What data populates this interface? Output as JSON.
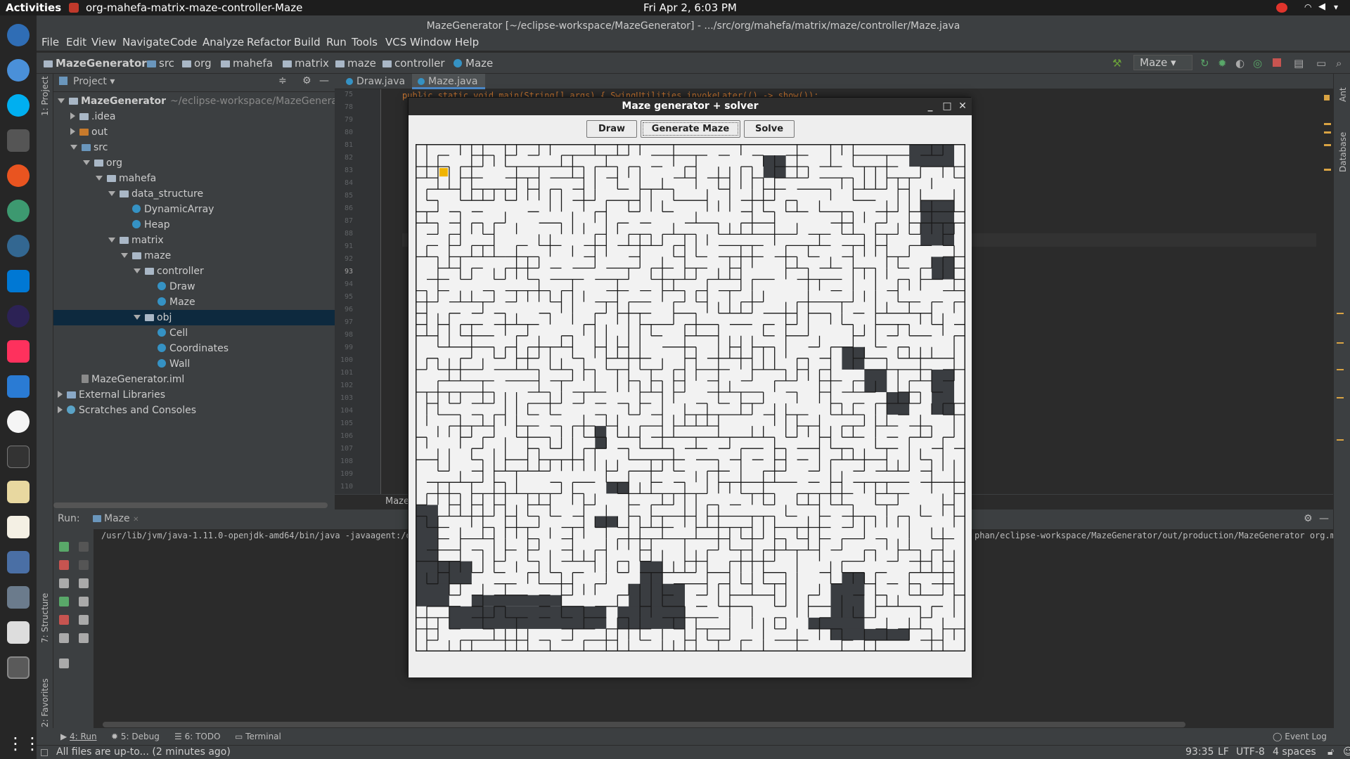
{
  "topbar": {
    "activities": "Activities",
    "app_name": "org-mahefa-matrix-maze-controller-Maze",
    "clock": "Fri Apr  2,  6:03 PM"
  },
  "ide": {
    "title": "MazeGenerator [~/eclipse-workspace/MazeGenerator] - .../src/org/mahefa/matrix/maze/controller/Maze.java",
    "menus": [
      "File",
      "Edit",
      "View",
      "Navigate",
      "Code",
      "Analyze",
      "Refactor",
      "Build",
      "Run",
      "Tools",
      "VCS",
      "Window",
      "Help"
    ],
    "breadcrumbs": [
      "MazeGenerator",
      "src",
      "org",
      "mahefa",
      "matrix",
      "maze",
      "controller",
      "Maze"
    ],
    "run_config": "Maze"
  },
  "project": {
    "header": "Project",
    "side_tab": "1: Project",
    "tree": [
      {
        "label": "MazeGenerator",
        "extra": "~/eclipse-workspace/MazeGenerator",
        "icon": "folder"
      },
      {
        "label": ".idea",
        "icon": "folder"
      },
      {
        "label": "out",
        "icon": "folder-orange"
      },
      {
        "label": "src",
        "icon": "folder-blue"
      },
      {
        "label": "org",
        "icon": "folder"
      },
      {
        "label": "mahefa",
        "icon": "folder"
      },
      {
        "label": "data_structure",
        "icon": "folder"
      },
      {
        "label": "DynamicArray",
        "icon": "class"
      },
      {
        "label": "Heap",
        "icon": "class"
      },
      {
        "label": "matrix",
        "icon": "folder"
      },
      {
        "label": "maze",
        "icon": "folder"
      },
      {
        "label": "controller",
        "icon": "folder"
      },
      {
        "label": "Draw",
        "icon": "class"
      },
      {
        "label": "Maze",
        "icon": "class"
      },
      {
        "label": "obj",
        "icon": "folder"
      },
      {
        "label": "Cell",
        "icon": "class"
      },
      {
        "label": "Coordinates",
        "icon": "class"
      },
      {
        "label": "Wall",
        "icon": "class"
      },
      {
        "label": "MazeGenerator.iml",
        "icon": "file"
      },
      {
        "label": "External Libraries",
        "icon": "library"
      },
      {
        "label": "Scratches and Consoles",
        "icon": "scratch"
      }
    ]
  },
  "editor": {
    "tabs": [
      "Draw.java",
      "Maze.java"
    ],
    "line_numbers": [
      "75",
      "78",
      "79",
      "80",
      "81",
      "82",
      "83",
      "84",
      "85",
      "86",
      "87",
      "88",
      "91",
      "92",
      "93",
      "94",
      "95",
      "96",
      "97",
      "98",
      "99",
      "100",
      "101",
      "102",
      "103",
      "104",
      "105",
      "106",
      "107",
      "108",
      "109",
      "110"
    ],
    "code_snippet": "public static void main(String[] args) { SwingUtilities.invokeLater(() -> show()); }",
    "breadcrumb_footer": "Maze"
  },
  "run": {
    "label": "Run:",
    "tab": "Maze",
    "cmd_left": "/usr/lib/jvm/java-1.11.0-openjdk-amd64/bin/java -javaagent:/op",
    "cmd_right": "phan/eclipse-workspace/MazeGenerator/out/production/MazeGenerator org.mahe"
  },
  "bottom_tabs": [
    "4: Run",
    "5: Debug",
    "6: TODO",
    "Terminal",
    "Event Log"
  ],
  "side_tabs": {
    "structure": "7: Structure",
    "favorites": "2: Favorites",
    "ant": "Ant",
    "database": "Database"
  },
  "status": {
    "message": "All files are up-to... (2 minutes ago)",
    "position": "93:35",
    "line_sep": "LF",
    "encoding": "UTF-8",
    "indent": "4 spaces"
  },
  "maze_window": {
    "title": "Maze generator + solver",
    "buttons": [
      "Draw",
      "Generate Maze",
      "Solve"
    ],
    "grid_cols": 49,
    "grid_rows": 45,
    "colors": {
      "background": "#f2f2f2",
      "wall": "#1a1a1a",
      "visited": "#3a3d41",
      "start": "#f0b400"
    }
  }
}
